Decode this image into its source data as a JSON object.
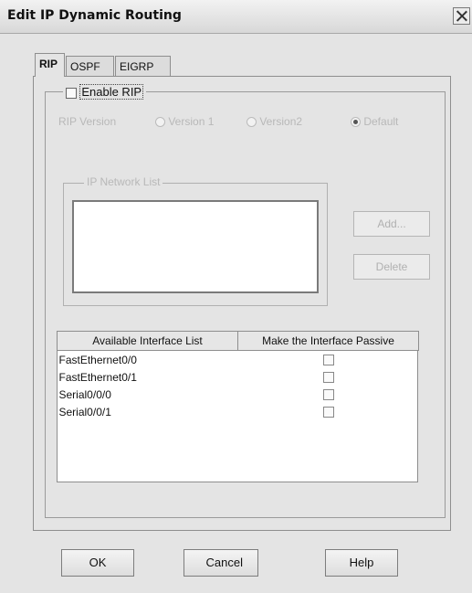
{
  "window": {
    "title": "Edit IP Dynamic Routing"
  },
  "tabs": [
    {
      "label": "RIP"
    },
    {
      "label": "OSPF"
    },
    {
      "label": "EIGRP"
    }
  ],
  "rip": {
    "enable_label": "Enable RIP",
    "enabled": false,
    "version_label": "RIP Version",
    "version_options": [
      "Version 1",
      "Version2",
      "Default"
    ],
    "selected_version": "Default",
    "network_list_label": "IP Network List",
    "network_list": [],
    "add_label": "Add...",
    "delete_label": "Delete"
  },
  "interfaces": {
    "headers": [
      "Available Interface List",
      "Make the Interface Passive"
    ],
    "rows": [
      {
        "name": "FastEthernet0/0",
        "passive": false
      },
      {
        "name": "FastEthernet0/1",
        "passive": false
      },
      {
        "name": "Serial0/0/0",
        "passive": false
      },
      {
        "name": "Serial0/0/1",
        "passive": false
      }
    ]
  },
  "footer": {
    "ok_label": "OK",
    "cancel_label": "Cancel",
    "help_label": "Help"
  },
  "icons": {
    "close": "close-icon"
  }
}
